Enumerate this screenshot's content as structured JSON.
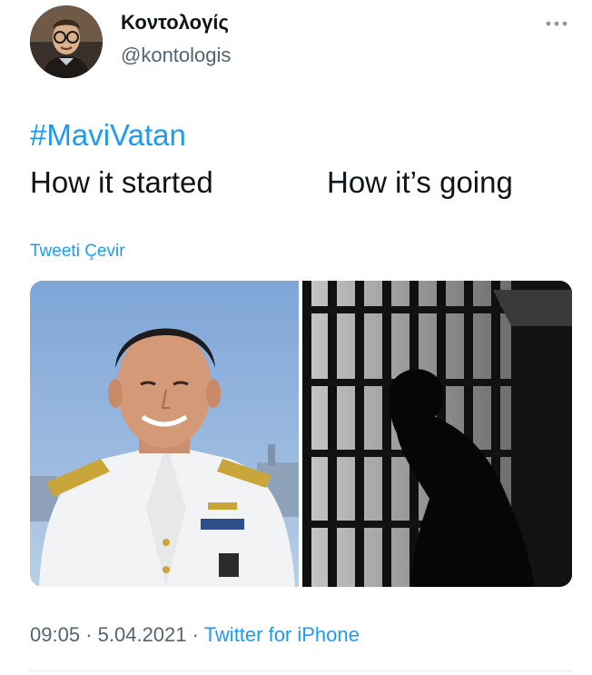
{
  "author": {
    "display_name": "Κοντολογίς",
    "handle": "@kontologis",
    "avatar_icon": "avatar-photo"
  },
  "tweet": {
    "hashtag": "#MaviVatan",
    "line_left": "How it started",
    "line_right": "How it’s going",
    "translate_label": "Tweeti Çevir"
  },
  "media": {
    "left_image": "officer-in-white-uniform-photo",
    "right_image": "man-in-jail-cell-photo"
  },
  "meta": {
    "time": "09:05",
    "separator": "·",
    "date": "5.04.2021",
    "source": "Twitter for iPhone"
  },
  "colors": {
    "accent": "#1d9bf0",
    "secondary_text": "#536471",
    "primary_text": "#0f1419"
  }
}
